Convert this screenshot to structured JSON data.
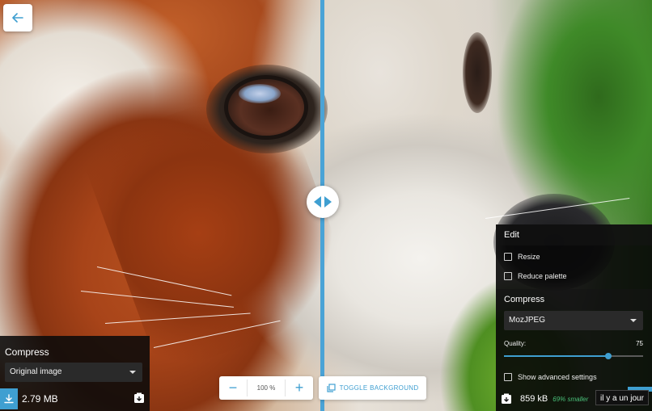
{
  "colors": {
    "accent": "#3f9fd1",
    "savings": "#4ac07a",
    "panel_bg": "#0a0a0a"
  },
  "back_button": {
    "icon": "arrow-left-icon"
  },
  "left_panel": {
    "heading": "Compress",
    "method_select": {
      "value": "Original image"
    },
    "file_size": "2.79 MB",
    "download_icon": "download-icon",
    "save_icon": "save-side-icon"
  },
  "zoom": {
    "decrease_label": "−",
    "value": "100",
    "unit": "%",
    "increase_label": "+"
  },
  "toggle_background": {
    "label": "TOGGLE BACKGROUND",
    "icon": "copy-icon"
  },
  "right_panel": {
    "edit_heading": "Edit",
    "resize_label": "Resize",
    "reduce_palette_label": "Reduce palette",
    "compress_heading": "Compress",
    "method_select": {
      "value": "MozJPEG"
    },
    "quality_label": "Quality:",
    "quality_value": "75",
    "quality_fraction": 0.75,
    "advanced_label": "Show advanced settings",
    "output_size": "859 kB",
    "savings_text": "69% smaller"
  },
  "tooltip": "il y a un jour"
}
